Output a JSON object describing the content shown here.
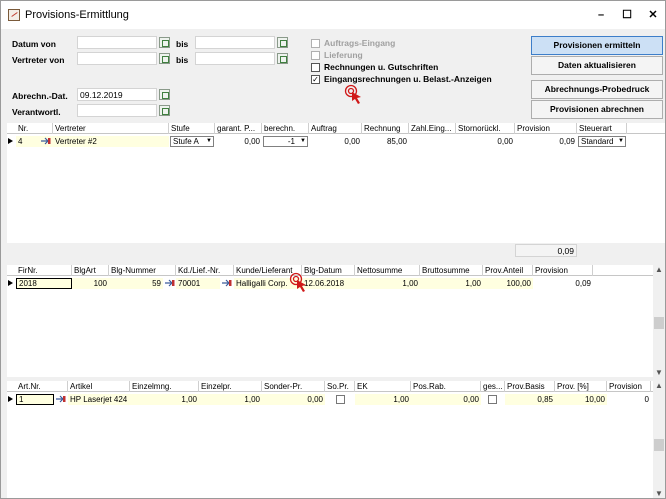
{
  "window": {
    "title": "Provisions-Ermittlung",
    "minimize": "–",
    "maximize": "☐",
    "close": "✕"
  },
  "form": {
    "datum_von_label": "Datum von",
    "bis_label_1": "bis",
    "vertreter_von_label": "Vertreter von",
    "bis_label_2": "bis",
    "abrechn_dat_label": "Abrechn.-Dat.",
    "abrechn_dat_value": "09.12.2019",
    "verantwortl_label": "Verantwortl.",
    "checkboxes": [
      {
        "label": "Auftrags-Eingang",
        "checked": false,
        "disabled": true
      },
      {
        "label": "Lieferung",
        "checked": false,
        "disabled": true
      },
      {
        "label": "Rechnungen u. Gutschriften",
        "checked": false,
        "disabled": false
      },
      {
        "label": "Eingangsrechnungen u. Belast.-Anzeigen",
        "checked": true,
        "disabled": false
      }
    ]
  },
  "buttons": {
    "provisionen_ermitteln": "Provisionen ermitteln",
    "daten_aktualisieren": "Daten aktualisieren",
    "abrechnungs_probedruck": "Abrechnungs-Probedruck",
    "provisionen_abrechnen": "Provisionen abrechnen"
  },
  "grid1": {
    "headers": [
      "Nr.",
      "Vertreter",
      "Stufe",
      "garant. P...",
      "berechn.",
      "Auftrag",
      "Rechnung",
      "Zahl.Eing...",
      "Stornorückl.",
      "Provision",
      "Steuerart"
    ],
    "row": {
      "nr": "4",
      "vertreter": "Vertreter #2",
      "stufe": "Stufe A",
      "garant": "0,00",
      "berechn": "-1",
      "auftrag": "0,00",
      "rechnung": "85,00",
      "zahl": "",
      "storno": "0,00",
      "provision": "0,09",
      "steuerart": "Standard"
    },
    "total": "0,09"
  },
  "grid2": {
    "headers": [
      "FirNr.",
      "BlgArt",
      "Blg-Nummer",
      "Kd./Lief.-Nr.",
      "Kunde/Lieferant",
      "Blg-Datum",
      "Nettosumme",
      "Bruttosumme",
      "Prov.Anteil",
      "Provision"
    ],
    "row": {
      "firnr": "2018",
      "blgart": "100",
      "blgnr": "59",
      "kdlief": "70001",
      "kunde": "Halligalli Corp.",
      "datum": "12.06.2018",
      "netto": "1,00",
      "brutto": "1,00",
      "anteil": "100,00",
      "provision": "0,09"
    }
  },
  "grid3": {
    "headers": [
      "Art.Nr.",
      "Artikel",
      "Einzelmng.",
      "Einzelpr.",
      "Sonder-Pr.",
      "So.Pr.",
      "EK",
      "Pos.Rab.",
      "ges...",
      "Prov.Basis",
      "Prov. [%]",
      "Provision"
    ],
    "row": {
      "artnr": "1",
      "artikel": "HP Laserjet 424",
      "mng": "1,00",
      "preis": "1,00",
      "sonder": "0,00",
      "ek": "1,00",
      "rab": "0,00",
      "basis": "0,85",
      "prozent": "10,00",
      "provision": "0"
    }
  },
  "colors": {
    "primary_button": "#cce0f5",
    "primary_border": "#3d7ec9",
    "input_yellow": "#ffffe0",
    "cursor_red": "#d01818"
  }
}
